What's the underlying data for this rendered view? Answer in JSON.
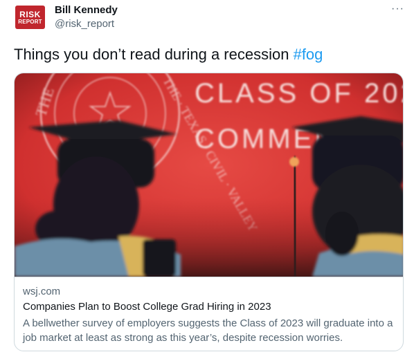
{
  "author": {
    "avatar_line1": "RISK",
    "avatar_line2": "REPORT",
    "name": "Bill Kennedy",
    "handle": "@risk_report"
  },
  "more_icon": "···",
  "tweet": {
    "text": "Things you don’t read during a recession ",
    "hashtag": "#fog"
  },
  "card": {
    "image": {
      "banner_line1": "CLASS OF 202",
      "banner_line2": "COMMEN",
      "seal_text": "THE · TEXAS · CIVIL · VALLEY"
    },
    "domain": "wsj.com",
    "title": "Companies Plan to Boost College Grad Hiring in 2023",
    "description": "A bellwether survey of employers suggests the Class of 2023 will graduate into a job market at least as strong as this year’s, despite recession worries."
  },
  "colors": {
    "accent": "#1d9bf0",
    "avatar": "#c0262d",
    "muted": "#536471",
    "banner_red": "#d83a3a"
  }
}
